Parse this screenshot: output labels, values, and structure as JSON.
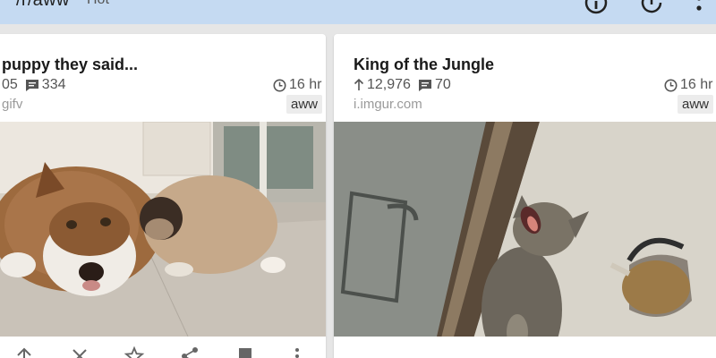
{
  "header": {
    "title": "/r/aww",
    "sort": "Hot",
    "colors": {
      "bar": "#c5daf2",
      "text": "#222222"
    },
    "icons": [
      "info-icon",
      "refresh-icon",
      "overflow-menu-icon"
    ]
  },
  "posts": [
    {
      "title": "puppy they said...",
      "score": "05",
      "comments": "334",
      "age": "16 hr",
      "domain": "gifv",
      "subreddit": "aww",
      "image_alt": "Husky lying on floor next to fluffy puppy"
    },
    {
      "title": "King of the Jungle",
      "score": "12,976",
      "comments": "70",
      "age": "16 hr",
      "domain": "i.imgur.com",
      "subreddit": "aww",
      "image_alt": "Kitten meowing next to a kettle"
    }
  ],
  "action_icons": [
    "upvote-icon",
    "downvote-icon",
    "star-icon",
    "share-icon",
    "save-icon",
    "more-icon"
  ]
}
